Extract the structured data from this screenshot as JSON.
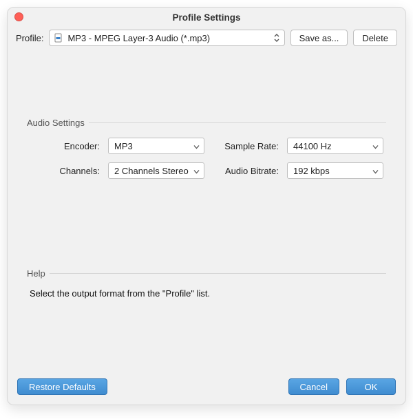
{
  "window": {
    "title": "Profile Settings"
  },
  "toolbar": {
    "profile_label": "Profile:",
    "profile_value": "MP3 - MPEG Layer-3 Audio (*.mp3)",
    "save_as_label": "Save as...",
    "delete_label": "Delete"
  },
  "audio": {
    "group_title": "Audio Settings",
    "encoder_label": "Encoder:",
    "encoder_value": "MP3",
    "sample_rate_label": "Sample Rate:",
    "sample_rate_value": "44100 Hz",
    "channels_label": "Channels:",
    "channels_value": "2 Channels Stereo",
    "bitrate_label": "Audio Bitrate:",
    "bitrate_value": "192 kbps"
  },
  "help": {
    "group_title": "Help",
    "text": "Select the output format from the \"Profile\" list."
  },
  "footer": {
    "restore_label": "Restore Defaults",
    "cancel_label": "Cancel",
    "ok_label": "OK"
  }
}
